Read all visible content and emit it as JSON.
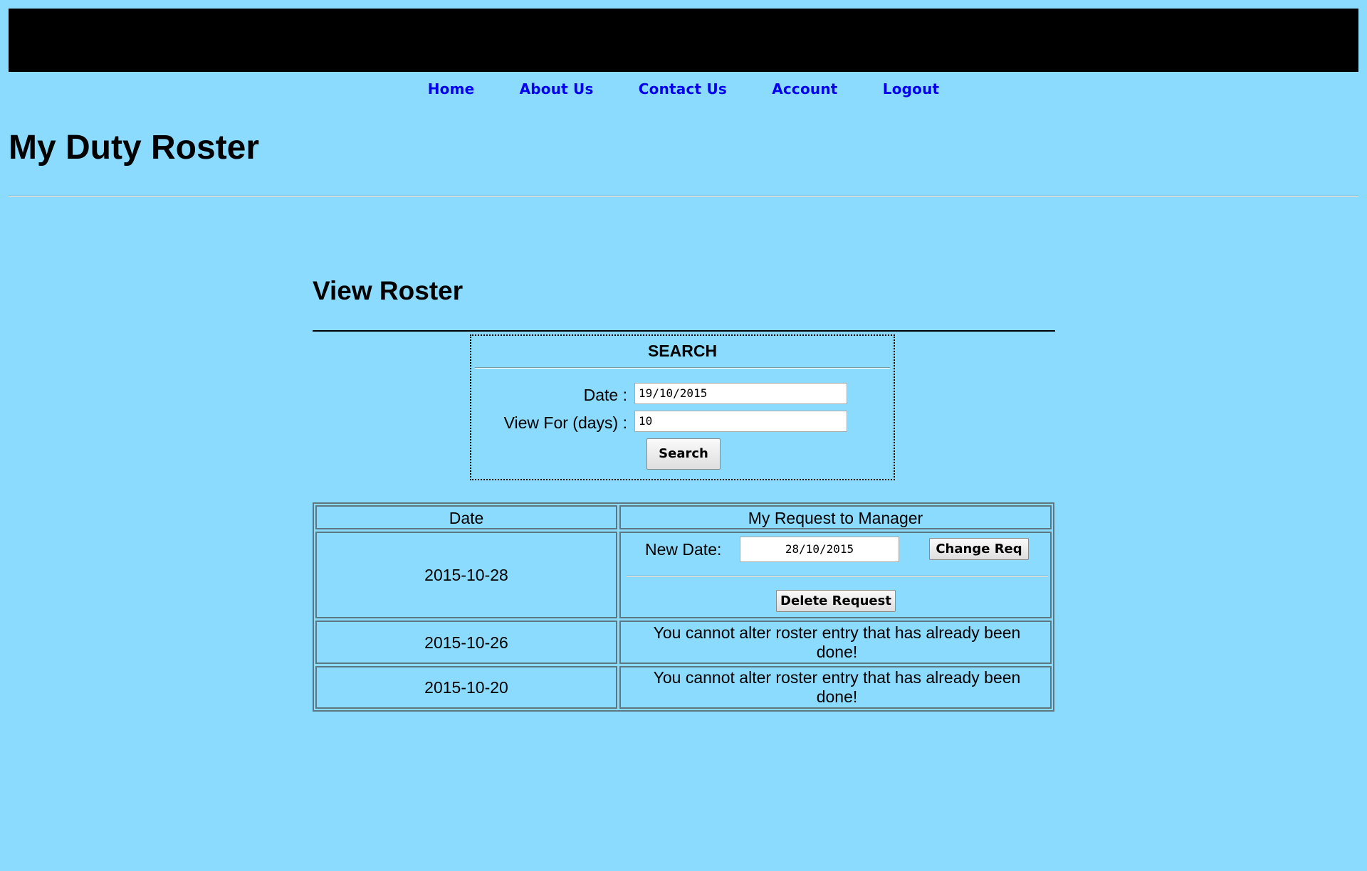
{
  "nav": {
    "items": [
      "Home",
      "About Us",
      "Contact Us",
      "Account",
      "Logout"
    ]
  },
  "page_title": "My Duty Roster",
  "section_title": "View Roster",
  "search": {
    "heading": "SEARCH",
    "date_label": "Date :",
    "date_value": "19/10/2015",
    "days_label": "View For (days) :",
    "days_value": "10",
    "button_label": "Search"
  },
  "table": {
    "headers": [
      "Date",
      "My Request to Manager"
    ],
    "rows": [
      {
        "date": "2015-10-28",
        "new_date_label": "New Date:",
        "new_date_value": "28/10/2015",
        "change_label": "Change Req",
        "delete_label": "Delete Request"
      },
      {
        "date": "2015-10-26",
        "message": "You cannot alter roster entry that has already been done!"
      },
      {
        "date": "2015-10-20",
        "message": "You cannot alter roster entry that has already been done!"
      }
    ]
  }
}
